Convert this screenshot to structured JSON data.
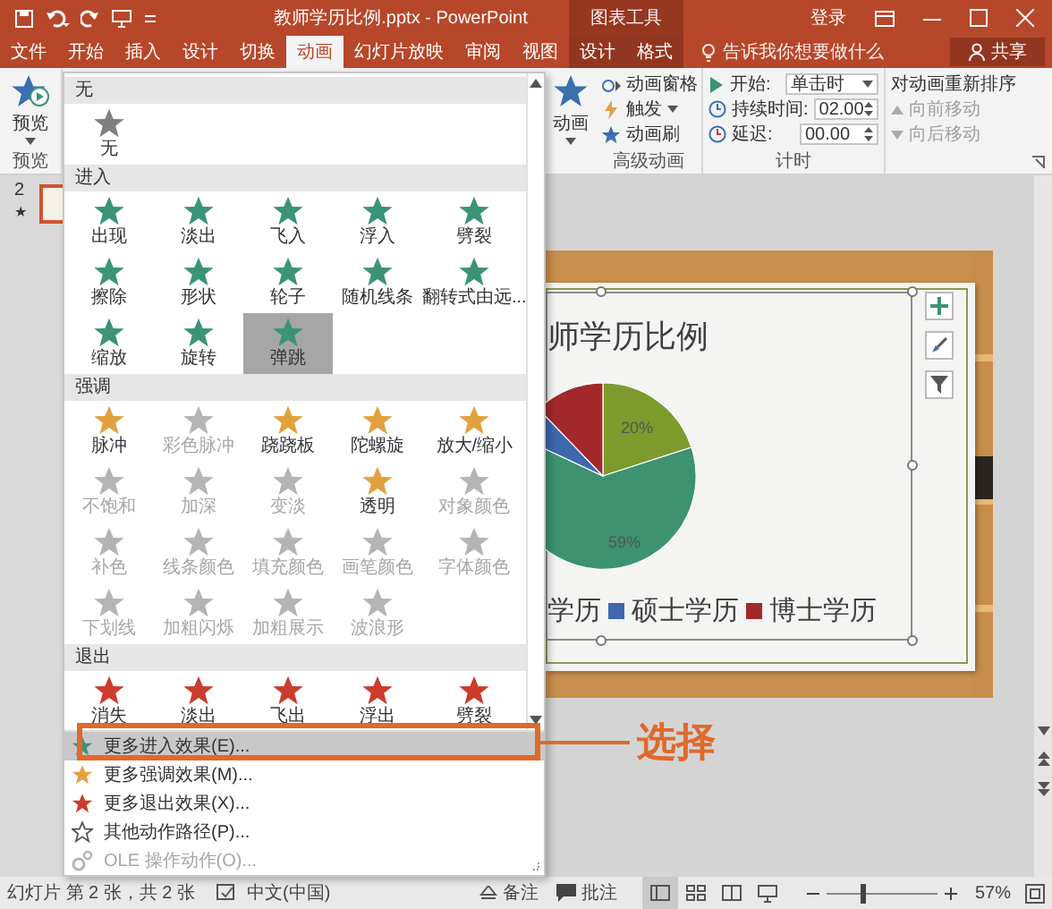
{
  "title_bar": {
    "title": "教师学历比例.pptx - PowerPoint",
    "context_label": "图表工具",
    "sign_in": "登录"
  },
  "tabs": [
    {
      "label": "文件",
      "selected": false,
      "contextual": false
    },
    {
      "label": "开始",
      "selected": false,
      "contextual": false
    },
    {
      "label": "插入",
      "selected": false,
      "contextual": false
    },
    {
      "label": "设计",
      "selected": false,
      "contextual": false
    },
    {
      "label": "切换",
      "selected": false,
      "contextual": false
    },
    {
      "label": "动画",
      "selected": true,
      "contextual": false
    },
    {
      "label": "幻灯片放映",
      "selected": false,
      "contextual": false
    },
    {
      "label": "审阅",
      "selected": false,
      "contextual": false
    },
    {
      "label": "视图",
      "selected": false,
      "contextual": false
    },
    {
      "label": "设计",
      "selected": false,
      "contextual": true
    },
    {
      "label": "格式",
      "selected": false,
      "contextual": true
    }
  ],
  "tell_me": "告诉我你想要做什么",
  "share": "共享",
  "ribbon": {
    "preview": {
      "button": "预览",
      "group": "预览"
    },
    "add_animation": "动画",
    "advanced": {
      "items": [
        {
          "label": "动画窗格",
          "kind": "pane"
        },
        {
          "label": "触发",
          "kind": "trigger"
        },
        {
          "label": "动画刷",
          "kind": "painter"
        }
      ],
      "group": "高级动画"
    },
    "timing": {
      "fields": [
        {
          "label": "开始:",
          "value": "单击时",
          "kind": "dropdown"
        },
        {
          "label": "持续时间:",
          "value": "02.00",
          "kind": "spinner"
        },
        {
          "label": "延迟:",
          "value": "00.00",
          "kind": "spinner"
        }
      ],
      "group": "计时"
    },
    "reorder": {
      "title": "对动画重新排序",
      "items": [
        {
          "label": "向前移动",
          "kind": "up",
          "disabled": true
        },
        {
          "label": "向后移动",
          "kind": "down",
          "disabled": true
        }
      ]
    }
  },
  "gallery": {
    "sections": [
      {
        "title": "无",
        "kind": "none",
        "items": [
          {
            "label": "无",
            "disabled": false,
            "selected": false
          }
        ]
      },
      {
        "title": "进入",
        "kind": "entrance",
        "items": [
          {
            "label": "出现",
            "disabled": false,
            "selected": false
          },
          {
            "label": "淡出",
            "disabled": false,
            "selected": false
          },
          {
            "label": "飞入",
            "disabled": false,
            "selected": false
          },
          {
            "label": "浮入",
            "disabled": false,
            "selected": false
          },
          {
            "label": "劈裂",
            "disabled": false,
            "selected": false
          },
          {
            "label": "擦除",
            "disabled": false,
            "selected": false
          },
          {
            "label": "形状",
            "disabled": false,
            "selected": false
          },
          {
            "label": "轮子",
            "disabled": false,
            "selected": false
          },
          {
            "label": "随机线条",
            "disabled": false,
            "selected": false
          },
          {
            "label": "翻转式由远...",
            "disabled": false,
            "selected": false
          },
          {
            "label": "缩放",
            "disabled": false,
            "selected": false
          },
          {
            "label": "旋转",
            "disabled": false,
            "selected": false
          },
          {
            "label": "弹跳",
            "disabled": false,
            "selected": true
          }
        ]
      },
      {
        "title": "强调",
        "kind": "emphasis",
        "items": [
          {
            "label": "脉冲",
            "disabled": false,
            "selected": false
          },
          {
            "label": "彩色脉冲",
            "disabled": true,
            "selected": false
          },
          {
            "label": "跷跷板",
            "disabled": false,
            "selected": false
          },
          {
            "label": "陀螺旋",
            "disabled": false,
            "selected": false
          },
          {
            "label": "放大/缩小",
            "disabled": false,
            "selected": false
          },
          {
            "label": "不饱和",
            "disabled": true,
            "selected": false
          },
          {
            "label": "加深",
            "disabled": true,
            "selected": false
          },
          {
            "label": "变淡",
            "disabled": true,
            "selected": false
          },
          {
            "label": "透明",
            "disabled": false,
            "selected": false
          },
          {
            "label": "对象颜色",
            "disabled": true,
            "selected": false
          },
          {
            "label": "补色",
            "disabled": true,
            "selected": false
          },
          {
            "label": "线条颜色",
            "disabled": true,
            "selected": false
          },
          {
            "label": "填充颜色",
            "disabled": true,
            "selected": false
          },
          {
            "label": "画笔颜色",
            "disabled": true,
            "selected": false
          },
          {
            "label": "字体颜色",
            "disabled": true,
            "selected": false
          },
          {
            "label": "下划线",
            "disabled": true,
            "selected": false
          },
          {
            "label": "加粗闪烁",
            "disabled": true,
            "selected": false
          },
          {
            "label": "加粗展示",
            "disabled": true,
            "selected": false
          },
          {
            "label": "波浪形",
            "disabled": true,
            "selected": false
          }
        ]
      },
      {
        "title": "退出",
        "kind": "exit",
        "items": [
          {
            "label": "消失",
            "disabled": false,
            "selected": false
          },
          {
            "label": "淡出",
            "disabled": false,
            "selected": false
          },
          {
            "label": "飞出",
            "disabled": false,
            "selected": false
          },
          {
            "label": "浮出",
            "disabled": false,
            "selected": false
          },
          {
            "label": "劈裂",
            "disabled": false,
            "selected": false
          }
        ]
      }
    ],
    "menu": [
      {
        "label": "更多进入效果(E)...",
        "kind": "entrance",
        "highlighted": true,
        "disabled": false
      },
      {
        "label": "更多强调效果(M)...",
        "kind": "emphasis",
        "highlighted": false,
        "disabled": false
      },
      {
        "label": "更多退出效果(X)...",
        "kind": "exit",
        "highlighted": false,
        "disabled": false
      },
      {
        "label": "其他动作路径(P)...",
        "kind": "path",
        "highlighted": false,
        "disabled": false
      },
      {
        "label": "OLE 操作动作(O)...",
        "kind": "ole",
        "highlighted": false,
        "disabled": true
      }
    ]
  },
  "slides_panel": {
    "number": "2",
    "marker": "★"
  },
  "slide": {
    "title": "师学历比例",
    "data_labels": [
      "20%",
      "59%"
    ],
    "legend": [
      {
        "label": "学历"
      },
      {
        "label": "硕士学历",
        "color": "#3d68ad"
      },
      {
        "label": "博士学历",
        "color": "#a3282c"
      }
    ]
  },
  "annotation": "选择",
  "status_bar": {
    "slide_info": "幻灯片 第 2 张，共 2 张",
    "language": "中文(中国)",
    "notes": "备注",
    "comments": "批注",
    "views": [
      {
        "kind": "normal",
        "selected": true
      },
      {
        "kind": "sorter",
        "selected": false
      },
      {
        "kind": "reading",
        "selected": false
      },
      {
        "kind": "show",
        "selected": false
      }
    ],
    "zoom": {
      "level": 0.3,
      "reading": "57%"
    }
  }
}
